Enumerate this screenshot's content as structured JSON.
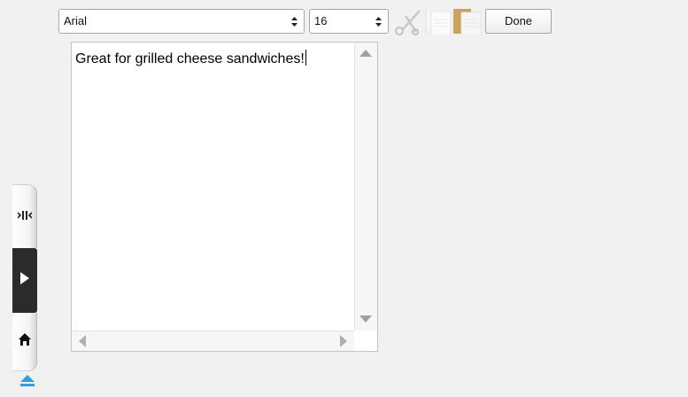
{
  "toolbar": {
    "font_select": {
      "value": "Arial",
      "icon": "updown-arrows-icon"
    },
    "size_select": {
      "value": "16",
      "icon": "updown-arrows-icon"
    },
    "cut_icon": "scissors-icon",
    "copy_icon": "copy-icon",
    "paste_icon": "paste-icon",
    "done_label": "Done"
  },
  "editor": {
    "text": "Great for grilled cheese sandwiches!"
  },
  "side_bar": {
    "items": [
      {
        "name": "split-view",
        "icon": "collapse-arrows-icon"
      },
      {
        "name": "play",
        "icon": "play-icon"
      },
      {
        "name": "home",
        "icon": "home-icon"
      }
    ],
    "eject_icon": "eject-icon"
  },
  "colors": {
    "background": "#f1f1f1",
    "paste_tan": "#c9a25c",
    "eject_blue": "#2f9be6",
    "side_active": "#2b2b2b"
  }
}
